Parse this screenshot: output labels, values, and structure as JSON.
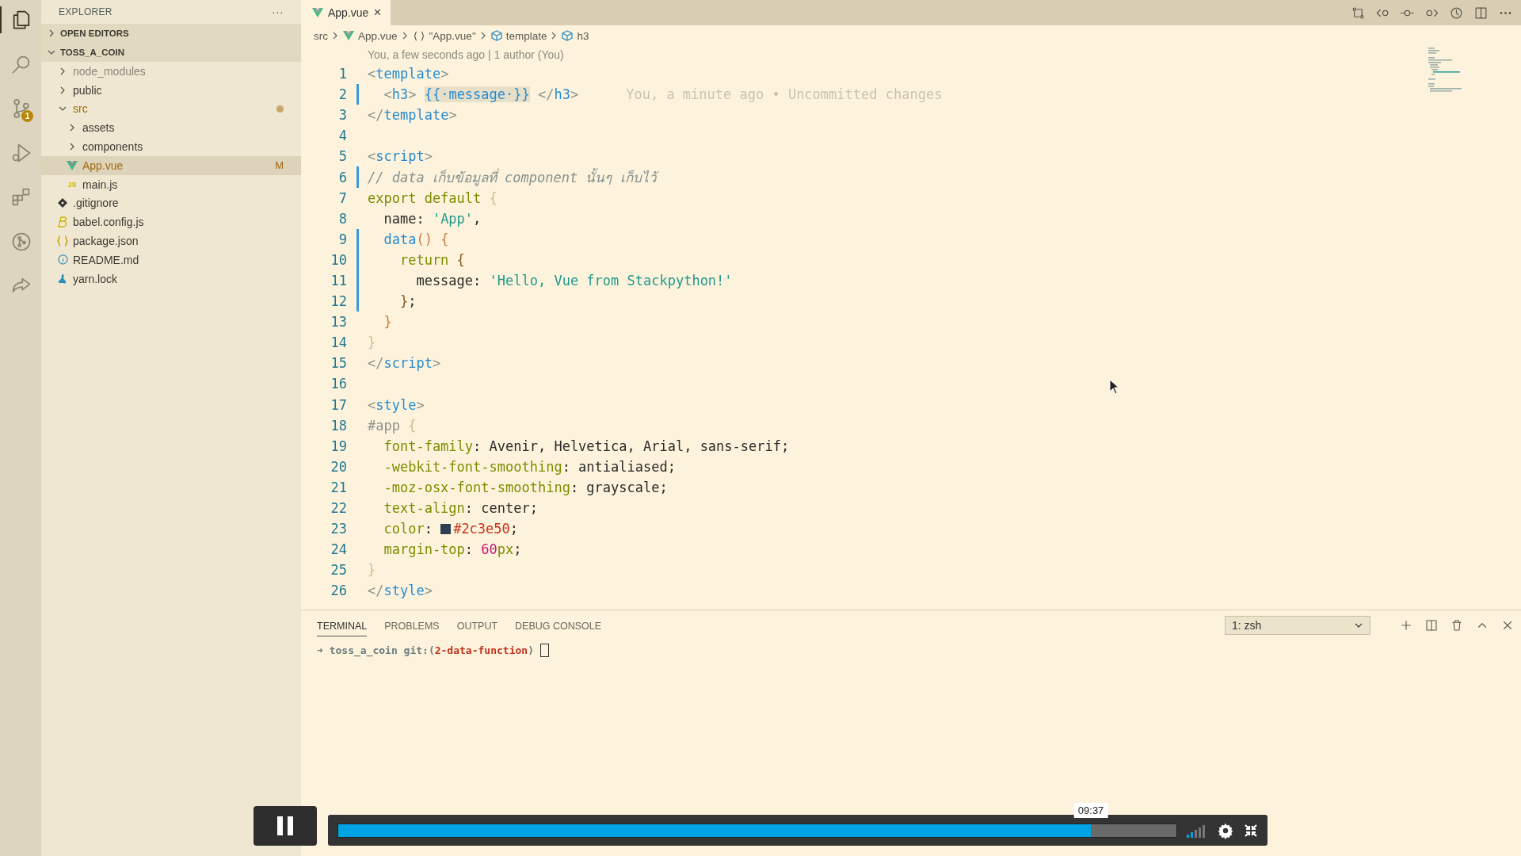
{
  "activity_bar": {
    "items": [
      {
        "kind": "files",
        "selected": true
      },
      {
        "kind": "search",
        "selected": false
      },
      {
        "kind": "scm",
        "selected": false,
        "badge": "1"
      },
      {
        "kind": "debug",
        "selected": false
      },
      {
        "kind": "extensions",
        "selected": false
      },
      {
        "kind": "graph",
        "selected": false
      },
      {
        "kind": "share",
        "selected": false
      }
    ]
  },
  "sidebar": {
    "title": "EXPLORER",
    "more": "···",
    "sections": [
      {
        "label": "OPEN EDITORS",
        "expanded": false
      },
      {
        "label": "TOSS_A_COIN",
        "expanded": true
      }
    ],
    "tree": [
      {
        "label": "node_modules",
        "kind": "folder",
        "expanded": false,
        "dimmed": true,
        "modified": false,
        "selected": false
      },
      {
        "label": "public",
        "kind": "folder",
        "expanded": false,
        "dimmed": false,
        "modified": false,
        "selected": false
      },
      {
        "label": "src",
        "kind": "folder",
        "expanded": true,
        "dimmed": false,
        "modified": true,
        "selected": false,
        "children": [
          {
            "label": "assets",
            "kind": "folder",
            "expanded": false,
            "dimmed": false,
            "modified": false,
            "selected": false
          },
          {
            "label": "components",
            "kind": "folder",
            "expanded": false,
            "dimmed": false,
            "modified": false,
            "selected": false
          },
          {
            "label": "App.vue",
            "kind": "vue",
            "dimmed": false,
            "modified": true,
            "selected": true,
            "status": "M"
          },
          {
            "label": "main.js",
            "kind": "js",
            "icon_text": "JS",
            "dimmed": false,
            "modified": false,
            "selected": false
          }
        ]
      },
      {
        "label": ".gitignore",
        "kind": "git",
        "dimmed": false,
        "modified": false,
        "selected": false
      },
      {
        "label": "babel.config.js",
        "kind": "babel",
        "dimmed": false,
        "modified": false,
        "selected": false
      },
      {
        "label": "package.json",
        "kind": "json",
        "dimmed": false,
        "modified": false,
        "selected": false
      },
      {
        "label": "README.md",
        "kind": "info",
        "dimmed": false,
        "modified": false,
        "selected": false
      },
      {
        "label": "yarn.lock",
        "kind": "yarn",
        "dimmed": false,
        "modified": false,
        "selected": false
      }
    ]
  },
  "tabs": [
    {
      "label": "App.vue",
      "selected": true,
      "close": "×"
    }
  ],
  "editor_actions": [
    {
      "kind": "compare"
    },
    {
      "kind": "prev-change"
    },
    {
      "kind": "commit"
    },
    {
      "kind": "next-change"
    },
    {
      "kind": "history"
    },
    {
      "kind": "split"
    },
    {
      "kind": "more"
    }
  ],
  "breadcrumb": [
    {
      "label": "src",
      "kind": "folder"
    },
    {
      "label": "App.vue",
      "kind": "vue"
    },
    {
      "label": "\"App.vue\"",
      "kind": "module"
    },
    {
      "label": "template",
      "kind": "element"
    },
    {
      "label": "h3",
      "kind": "element"
    }
  ],
  "codelens": "You, a few seconds ago | 1 author (You)",
  "lines": [
    {
      "number": "1",
      "modified": false,
      "tokens": [
        {
          "text": "<",
          "color": "#8d948e"
        },
        {
          "text": "template",
          "color": "#268bd2"
        },
        {
          "text": ">",
          "color": "#8d948e"
        }
      ]
    },
    {
      "number": "2",
      "modified": true,
      "blame": "You, a minute ago • Uncommitted changes",
      "tokens": [
        {
          "text": "  <",
          "color": "#8d948e",
          "highlighted": false
        },
        {
          "text": "h3",
          "color": "#268bd2",
          "highlighted": false
        },
        {
          "text": "> ",
          "color": "#8d948e",
          "highlighted": false
        },
        {
          "text": "{{·message·}}",
          "color": "#268bd2",
          "highlighted": true
        },
        {
          "text": " </",
          "color": "#8d948e",
          "highlighted": false
        },
        {
          "text": "h3",
          "color": "#268bd2",
          "highlighted": false
        },
        {
          "text": ">",
          "color": "#8d948e",
          "highlighted": false
        }
      ]
    },
    {
      "number": "3",
      "modified": false,
      "tokens": [
        {
          "text": "</",
          "color": "#8d948e"
        },
        {
          "text": "template",
          "color": "#268bd2"
        },
        {
          "text": ">",
          "color": "#8d948e"
        }
      ]
    },
    {
      "number": "4",
      "modified": false
    },
    {
      "number": "5",
      "modified": false,
      "tokens": [
        {
          "text": "<",
          "color": "#8d948e"
        },
        {
          "text": "script",
          "color": "#268bd2"
        },
        {
          "text": ">",
          "color": "#8d948e"
        }
      ]
    },
    {
      "number": "6",
      "modified": true,
      "tokens": [
        {
          "text": "// data เก็บข้อมูลที่ component นั้นๆ เก็บไว้",
          "color": "#84918f",
          "italic": true
        }
      ]
    },
    {
      "number": "7",
      "modified": false,
      "tokens": [
        {
          "text": "export default ",
          "color": "#7f8c00"
        },
        {
          "text": "{",
          "color": "#c9c08e"
        }
      ]
    },
    {
      "number": "8",
      "modified": false,
      "tokens": [
        {
          "text": "  name: ",
          "color": "#2a2a28"
        },
        {
          "text": "'App'",
          "color": "#20998c"
        },
        {
          "text": ",",
          "color": "#2a2a28"
        }
      ]
    },
    {
      "number": "9",
      "modified": true,
      "tokens": [
        {
          "text": "  data",
          "color": "#268bd2"
        },
        {
          "text": "() {",
          "color": "#cb7d3e"
        }
      ]
    },
    {
      "number": "10",
      "modified": true,
      "tokens": [
        {
          "text": "    return ",
          "color": "#7f8c00"
        },
        {
          "text": "{",
          "color": "#8a5a1a"
        }
      ]
    },
    {
      "number": "11",
      "modified": true,
      "tokens": [
        {
          "text": "      message: ",
          "color": "#2a2a28"
        },
        {
          "text": "'Hello, Vue from Stackpython!'",
          "color": "#20998c"
        }
      ]
    },
    {
      "number": "12",
      "modified": true,
      "tokens": [
        {
          "text": "    }",
          "color": "#8a5a1a"
        },
        {
          "text": ";",
          "color": "#2a2a28"
        }
      ]
    },
    {
      "number": "13",
      "modified": false,
      "tokens": [
        {
          "text": "  }",
          "color": "#cb7d3e"
        }
      ]
    },
    {
      "number": "14",
      "modified": false,
      "tokens": [
        {
          "text": "}",
          "color": "#c9c08e"
        }
      ]
    },
    {
      "number": "15",
      "modified": false,
      "tokens": [
        {
          "text": "</",
          "color": "#8d948e"
        },
        {
          "text": "script",
          "color": "#268bd2"
        },
        {
          "text": ">",
          "color": "#8d948e"
        }
      ]
    },
    {
      "number": "16",
      "modified": false
    },
    {
      "number": "17",
      "modified": false,
      "tokens": [
        {
          "text": "<",
          "color": "#8d948e"
        },
        {
          "text": "style",
          "color": "#268bd2"
        },
        {
          "text": ">",
          "color": "#8d948e"
        }
      ]
    },
    {
      "number": "18",
      "modified": false,
      "tokens": [
        {
          "text": "#app ",
          "color": "#8d948e"
        },
        {
          "text": "{",
          "color": "#c9c08e"
        }
      ]
    },
    {
      "number": "19",
      "modified": false,
      "tokens": [
        {
          "text": "  font-family",
          "color": "#7f8c00"
        },
        {
          "text": ": Avenir, Helvetica, Arial, sans-serif;",
          "color": "#2a2a28"
        }
      ]
    },
    {
      "number": "20",
      "modified": false,
      "tokens": [
        {
          "text": "  -webkit-font-smoothing",
          "color": "#7f8c00"
        },
        {
          "text": ": antialiased;",
          "color": "#2a2a28"
        }
      ]
    },
    {
      "number": "21",
      "modified": false,
      "tokens": [
        {
          "text": "  -moz-osx-font-smoothing",
          "color": "#7f8c00"
        },
        {
          "text": ": grayscale;",
          "color": "#2a2a28"
        }
      ]
    },
    {
      "number": "22",
      "modified": false,
      "tokens": [
        {
          "text": "  text-align",
          "color": "#7f8c00"
        },
        {
          "text": ": center;",
          "color": "#2a2a28"
        }
      ]
    },
    {
      "number": "23",
      "modified": false,
      "tokens": [
        {
          "text": "  color",
          "color": "#7f8c00"
        },
        {
          "text": ": ",
          "color": "#2a2a28"
        },
        {
          "swatch": true,
          "color": "#2c3e50"
        },
        {
          "text": "#2c3e50",
          "color": "#c8321c"
        },
        {
          "text": ";",
          "color": "#2a2a28"
        }
      ]
    },
    {
      "number": "24",
      "modified": false,
      "tokens": [
        {
          "text": "  margin-top",
          "color": "#7f8c00"
        },
        {
          "text": ": ",
          "color": "#2a2a28"
        },
        {
          "text": "60",
          "color": "#c9167c"
        },
        {
          "text": "px",
          "color": "#7f8c00"
        },
        {
          "text": ";",
          "color": "#2a2a28"
        }
      ]
    },
    {
      "number": "25",
      "modified": false,
      "tokens": [
        {
          "text": "}",
          "color": "#c9c08e"
        }
      ]
    },
    {
      "number": "26",
      "modified": false,
      "tokens": [
        {
          "text": "</",
          "color": "#8d948e"
        },
        {
          "text": "style",
          "color": "#268bd2"
        },
        {
          "text": ">",
          "color": "#8d948e"
        }
      ]
    }
  ],
  "panel": {
    "tabs": [
      {
        "label": "TERMINAL",
        "selected": true
      },
      {
        "label": "PROBLEMS",
        "selected": false
      },
      {
        "label": "OUTPUT",
        "selected": false
      },
      {
        "label": "DEBUG CONSOLE",
        "selected": false
      }
    ],
    "terminal_select": "1: zsh",
    "actions": [
      {
        "kind": "add"
      },
      {
        "kind": "split"
      },
      {
        "kind": "trash"
      },
      {
        "kind": "maximize"
      },
      {
        "kind": "close"
      }
    ],
    "prompt": {
      "arrow": "➜",
      "dir": "toss_a_coin",
      "git_open": "git:(",
      "branch": "2-data-function",
      "git_close": ")"
    }
  },
  "player": {
    "level": 0.898,
    "time": "09:37",
    "playing": true
  }
}
